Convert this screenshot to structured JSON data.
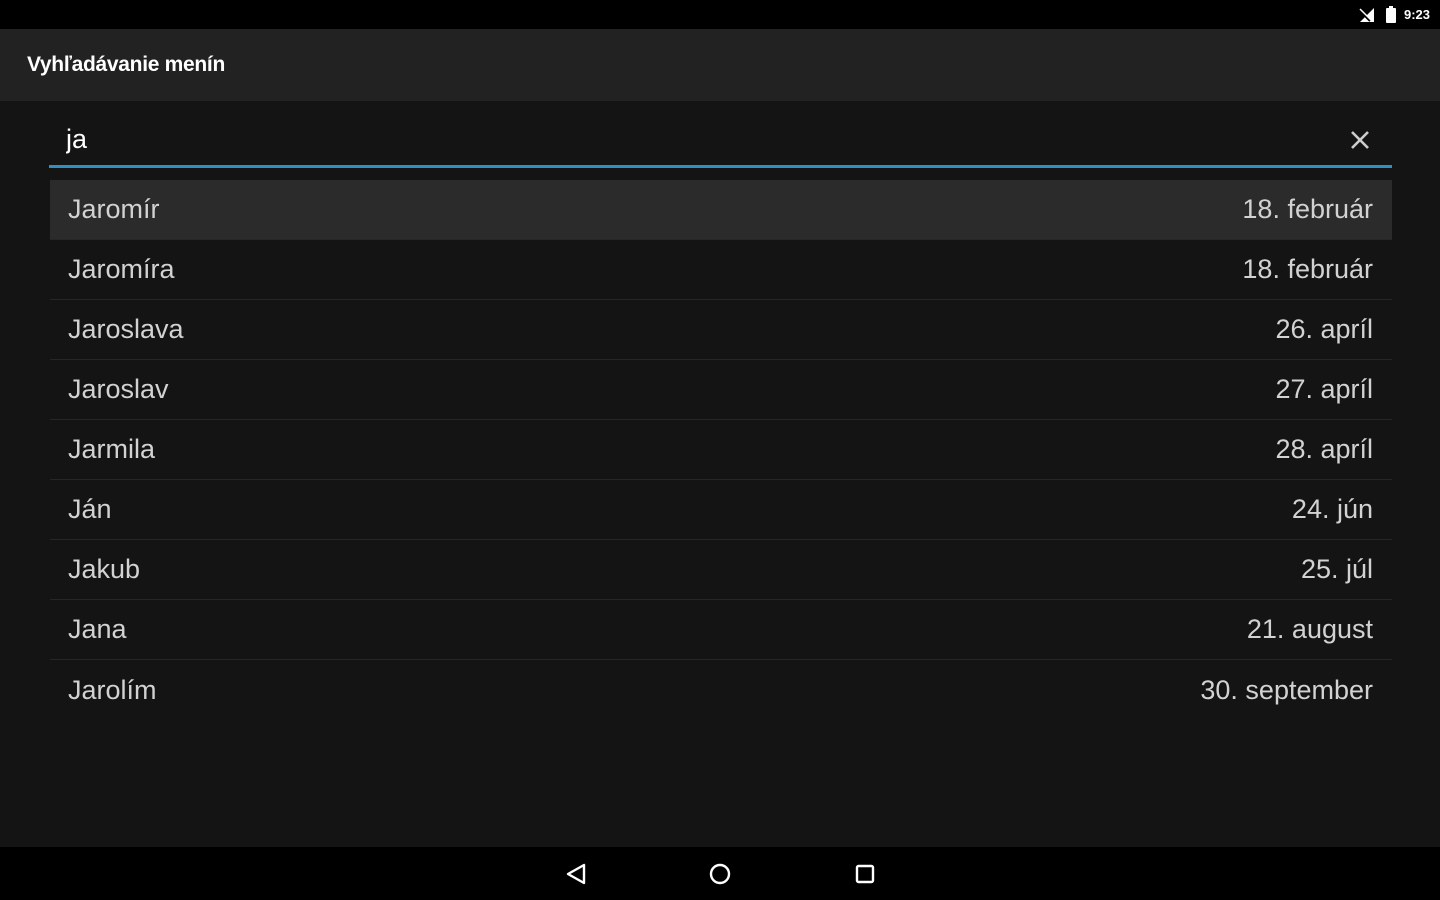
{
  "status_bar": {
    "time": "9:23",
    "icons": [
      "signal-icon",
      "battery-icon"
    ]
  },
  "app_bar": {
    "title": "Vyhľadávanie menín"
  },
  "search": {
    "value": "ja",
    "clear_icon": "close-icon",
    "accent_color": "#2f8fc4"
  },
  "results": [
    {
      "name": "Jaromír",
      "date": "18. február"
    },
    {
      "name": "Jaromíra",
      "date": "18. február"
    },
    {
      "name": "Jaroslava",
      "date": "26. apríl"
    },
    {
      "name": "Jaroslav",
      "date": "27. apríl"
    },
    {
      "name": "Jarmila",
      "date": "28. apríl"
    },
    {
      "name": "Ján",
      "date": "24. jún"
    },
    {
      "name": "Jakub",
      "date": "25. júl"
    },
    {
      "name": "Jana",
      "date": "21. august"
    },
    {
      "name": "Jarolím",
      "date": "30. september"
    }
  ],
  "nav_bar": {
    "icons": [
      "back-icon",
      "home-icon",
      "recents-icon"
    ]
  }
}
